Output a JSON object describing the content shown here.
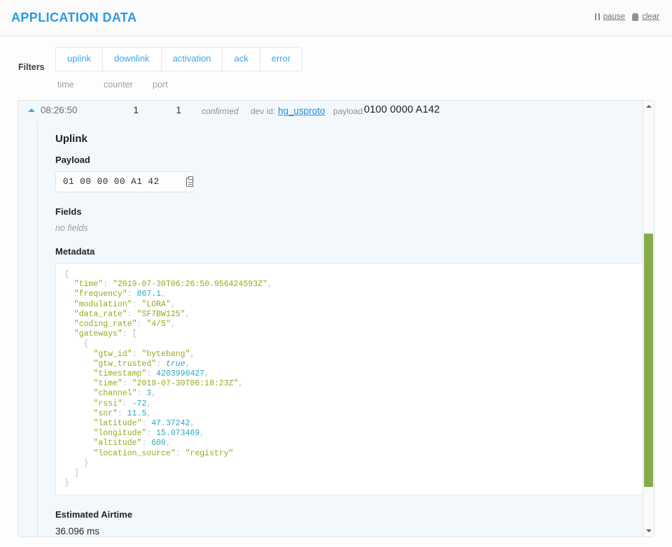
{
  "header": {
    "title": "APPLICATION DATA",
    "pause_label": "pause",
    "clear_label": "clear",
    "pause_icon": "pause-icon",
    "clear_icon": "trash-icon",
    "accent_color": "#2a9ae0"
  },
  "filters": {
    "label": "Filters",
    "buttons": [
      {
        "label": "uplink"
      },
      {
        "label": "downlink"
      },
      {
        "label": "activation"
      },
      {
        "label": "ack"
      },
      {
        "label": "error"
      }
    ]
  },
  "columns": {
    "time": "time",
    "counter": "counter",
    "port": "port"
  },
  "event": {
    "caret_icon": "caret-up-icon",
    "time": "08:26:50",
    "counter": "1",
    "port": "1",
    "confirmed": "confirmed",
    "devid_label": "dev id:",
    "devid_value": "hg_usproto",
    "payload_label": "payload:",
    "payload_value": "0100 0000 A142"
  },
  "detail": {
    "section_title": "Uplink",
    "payload_title": "Payload",
    "payload_value": "01 00 00 00 A1 42",
    "copy_icon": "clipboard-icon",
    "fields_title": "Fields",
    "fields_empty": "no fields",
    "metadata_title": "Metadata",
    "metadata_json": "{\n  \"time\": \"2019-07-30T06:26:50.956424593Z\",\n  \"frequency\": 867.1,\n  \"modulation\": \"LORA\",\n  \"data_rate\": \"SF7BW125\",\n  \"coding_rate\": \"4/5\",\n  \"gateways\": [\n    {\n      \"gtw_id\": \"bytebang\",\n      \"gtw_trusted\": true,\n      \"timestamp\": 4203990427,\n      \"time\": \"2019-07-30T06:18:23Z\",\n      \"channel\": 3,\n      \"rssi\": -72,\n      \"snr\": 11.5,\n      \"latitude\": 47.37242,\n      \"longitude\": 15.073469,\n      \"altitude\": 600,\n      \"location_source\": \"registry\"\n    }\n  ]\n}",
    "metadata_fields": {
      "time": "2019-07-30T06:26:50.956424593Z",
      "frequency": 867.1,
      "modulation": "LORA",
      "data_rate": "SF7BW125",
      "coding_rate": "4/5",
      "gateways": [
        {
          "gtw_id": "bytebang",
          "gtw_trusted": true,
          "timestamp": 4203990427,
          "time": "2019-07-30T06:18:23Z",
          "channel": 3,
          "rssi": -72,
          "snr": 11.5,
          "latitude": 47.37242,
          "longitude": 15.073469,
          "altitude": 600,
          "location_source": "registry"
        }
      ]
    },
    "airtime_title": "Estimated Airtime",
    "airtime_value": "36.096 ms"
  },
  "scrollbar": {
    "up_icon": "scroll-up-arrow-icon",
    "down_icon": "scroll-down-arrow-icon",
    "thumb_color": "#86ab49"
  }
}
